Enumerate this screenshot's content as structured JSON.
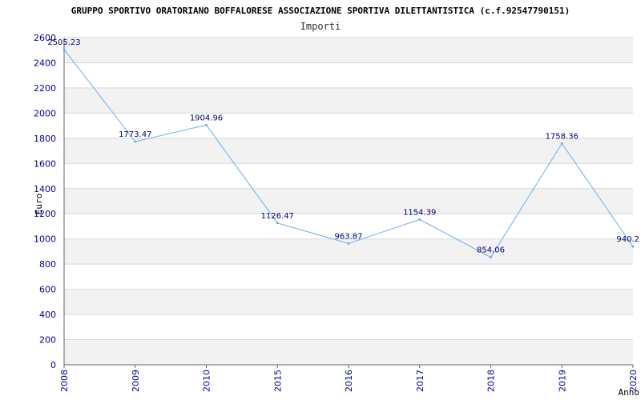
{
  "chart_data": {
    "type": "line",
    "title": "GRUPPO SPORTIVO ORATORIANO BOFFALORESE ASSOCIAZIONE SPORTIVA DILETTANTISTICA (c.f.92547790151)",
    "subtitle": "Importi",
    "xlabel": "Anno",
    "ylabel": "Euro",
    "categories": [
      "2008",
      "2009",
      "2010",
      "2015",
      "2016",
      "2017",
      "2018",
      "2019",
      "2020"
    ],
    "values": [
      2505.23,
      1773.47,
      1904.96,
      1126.47,
      963.87,
      1154.39,
      854.06,
      1758.36,
      940.2
    ],
    "data_labels": [
      "2505.23",
      "1773.47",
      "1904.96",
      "1126.47",
      "963.87",
      "1154.39",
      "854.06",
      "1758.36",
      "940.2"
    ],
    "ylim": [
      0,
      2600
    ],
    "yticks": [
      "0",
      "200",
      "400",
      "600",
      "800",
      "1000",
      "1200",
      "1400",
      "1600",
      "1800",
      "2000",
      "2200",
      "2400",
      "2600"
    ],
    "grid": true,
    "legend": "none",
    "colors": {
      "line": "#6aaef0",
      "band": "#f2f2f2",
      "gridline": "#d9d9d9",
      "axis": "#666666",
      "tick_text": "#0000aa",
      "label_text": "#000080"
    }
  }
}
